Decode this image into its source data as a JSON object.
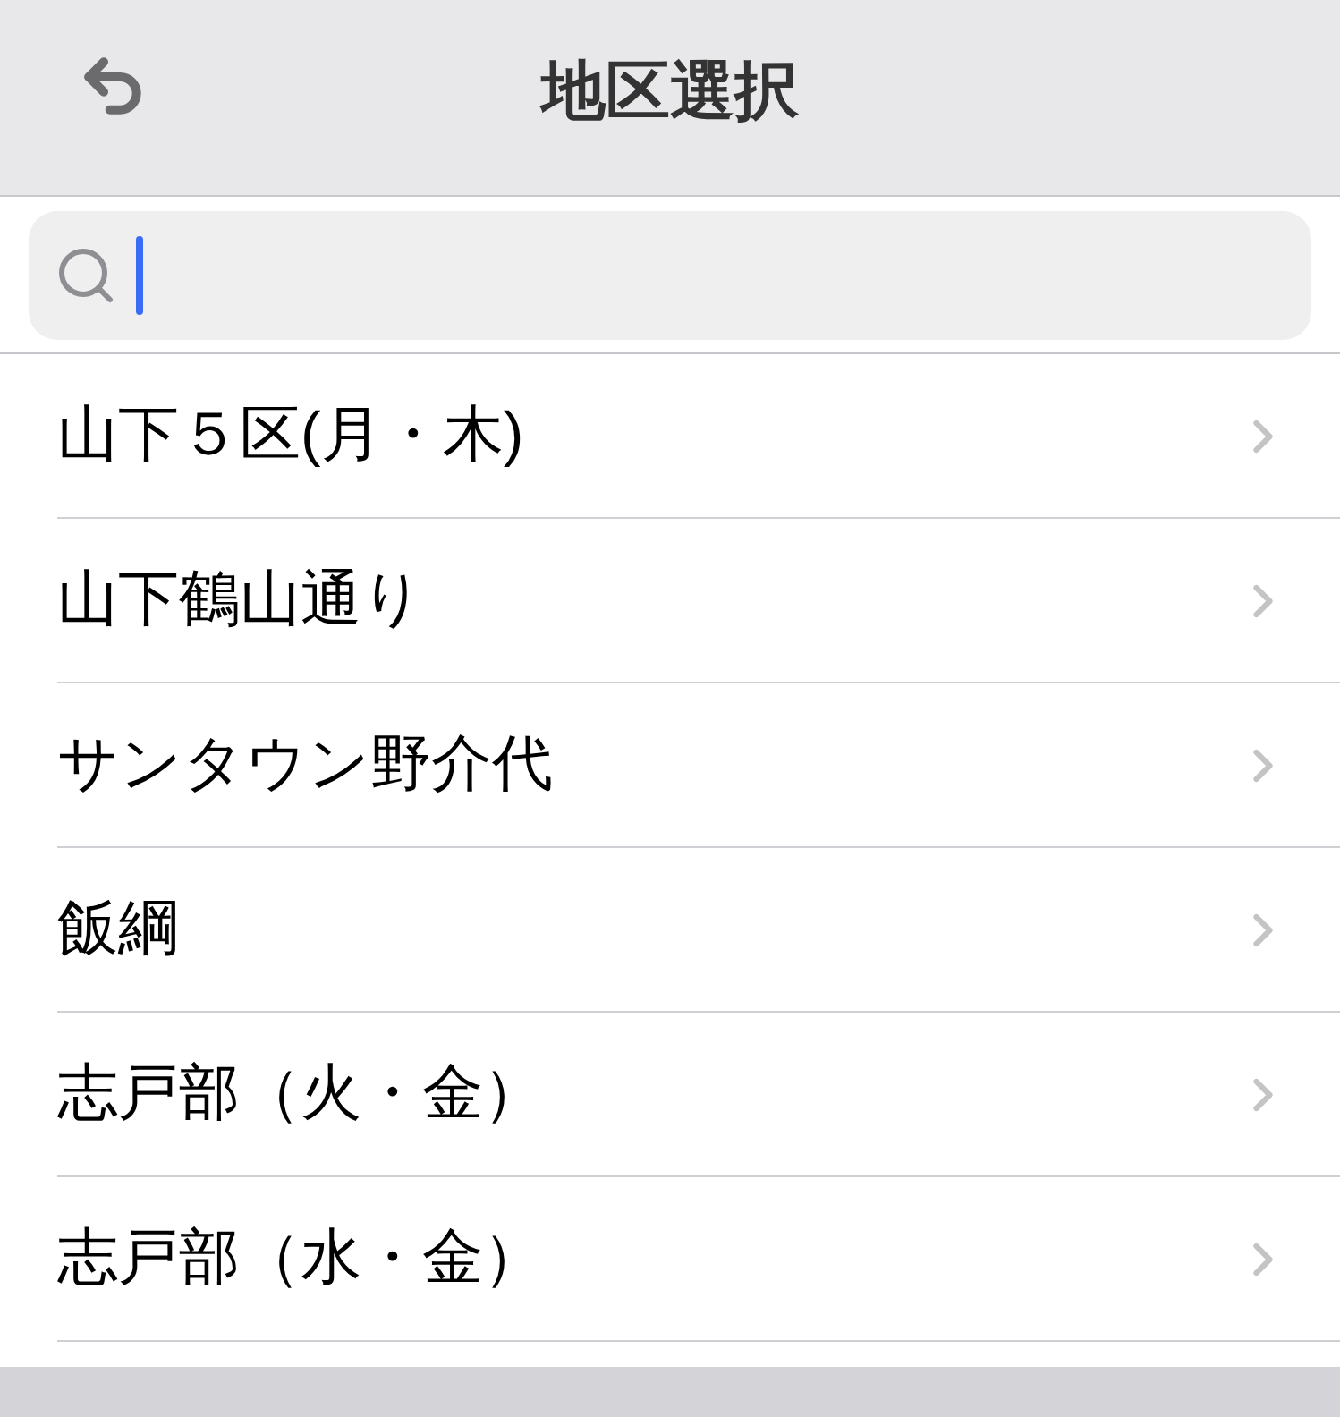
{
  "header": {
    "title": "地区選択"
  },
  "areas": [
    {
      "name": "山下５区(月・木)"
    },
    {
      "name": "山下鶴山通り"
    },
    {
      "name": "サンタウン野介代"
    },
    {
      "name": "飯綱"
    },
    {
      "name": "志戸部（火・金）"
    },
    {
      "name": "志戸部（水・金）"
    }
  ]
}
